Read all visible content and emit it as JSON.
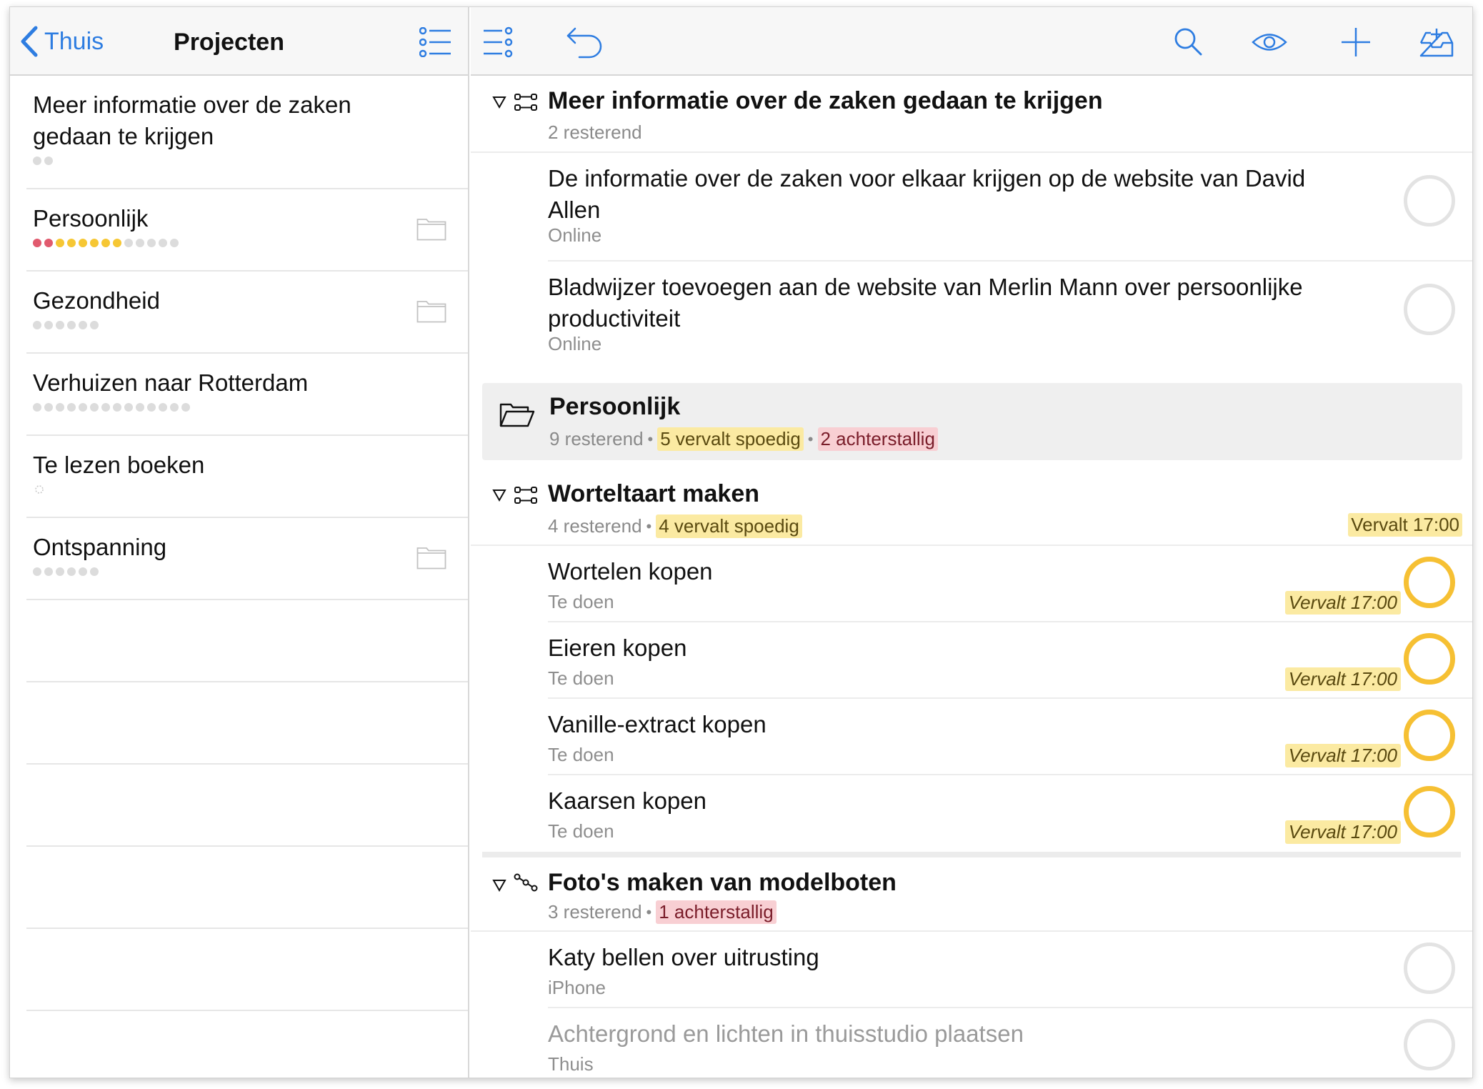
{
  "sidebar": {
    "back_label": "Thuis",
    "title": "Projecten",
    "projects": [
      {
        "name": "Meer informatie over de zaken gedaan te krijgen",
        "dots": [
          "gray",
          "gray"
        ],
        "folder": false
      },
      {
        "name": "Persoonlijk",
        "dots": [
          "red",
          "red",
          "yellow",
          "yellow",
          "yellow",
          "yellow",
          "yellow",
          "yellow",
          "gray",
          "gray",
          "gray",
          "gray",
          "gray"
        ],
        "folder": true
      },
      {
        "name": "Gezondheid",
        "dots": [
          "gray",
          "gray",
          "gray",
          "gray",
          "gray",
          "gray"
        ],
        "folder": true
      },
      {
        "name": "Verhuizen naar Rotterdam",
        "dots": [
          "gray",
          "gray",
          "gray",
          "gray",
          "gray",
          "gray",
          "gray",
          "gray",
          "gray",
          "gray",
          "gray",
          "gray",
          "gray",
          "gray"
        ],
        "folder": false
      },
      {
        "name": "Te lezen boeken",
        "dots": [],
        "folder": false
      },
      {
        "name": "Ontspanning",
        "dots": [
          "gray",
          "gray",
          "gray",
          "gray",
          "gray",
          "gray"
        ],
        "folder": true
      }
    ]
  },
  "toolbar": {
    "icons": [
      "view-options-icon",
      "undo-icon",
      "search-icon",
      "eye-icon",
      "add-icon",
      "inbox-add-icon"
    ]
  },
  "main": {
    "group1": {
      "title": "Meer informatie over de zaken gedaan te krijgen",
      "remaining": "2 resterend",
      "tasks": [
        {
          "title": "De informatie over de zaken voor elkaar krijgen op de website van David Allen",
          "context": "Online"
        },
        {
          "title": "Bladwijzer toevoegen aan de website van Merlin Mann over persoonlijke productiviteit",
          "context": "Online"
        }
      ]
    },
    "folder": {
      "title": "Persoonlijk",
      "remaining": "9 resterend",
      "due_soon": "5 vervalt spoedig",
      "overdue": "2 achterstallig"
    },
    "group2": {
      "title": "Worteltaart maken",
      "remaining": "4 resterend",
      "due_soon": "4 vervalt spoedig",
      "due": "Vervalt 17:00",
      "tasks": [
        {
          "title": "Wortelen kopen",
          "context": "Te doen",
          "due": "Vervalt 17:00"
        },
        {
          "title": "Eieren kopen",
          "context": "Te doen",
          "due": "Vervalt 17:00"
        },
        {
          "title": "Vanille-extract kopen",
          "context": "Te doen",
          "due": "Vervalt 17:00"
        },
        {
          "title": "Kaarsen kopen",
          "context": "Te doen",
          "due": "Vervalt 17:00"
        }
      ]
    },
    "group3": {
      "title": "Foto's maken van modelboten",
      "remaining": "3 resterend",
      "overdue": "1 achterstallig",
      "tasks": [
        {
          "title": "Katy bellen over uitrusting",
          "context": "iPhone"
        },
        {
          "title": "Achtergrond en lichten in thuisstudio plaatsen",
          "context": "Thuis"
        }
      ]
    },
    "separator": "•"
  },
  "colors": {
    "accent": "#2e7de1",
    "due_soon_bg": "#fbeaa2",
    "overdue_bg": "#f8cfd3",
    "due_ring": "#f6c033"
  }
}
